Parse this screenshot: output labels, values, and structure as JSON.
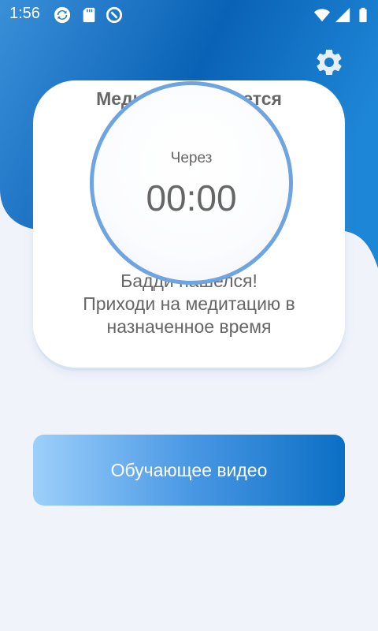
{
  "status_bar": {
    "time": "1:56",
    "left_icons": [
      "sync-icon",
      "sd-card-icon",
      "do-not-disturb-icon"
    ],
    "right_icons": [
      "wifi-icon",
      "cell-signal-icon",
      "battery-icon"
    ]
  },
  "header": {
    "settings_icon": "gear-icon"
  },
  "card": {
    "title": "Медитация начнется",
    "message_line1": "Бадди нашелся!",
    "message_line2": "Приходи на медитацию в",
    "message_line3": "назначенное время"
  },
  "timer": {
    "label": "Через",
    "value": "00:00"
  },
  "video_button": {
    "label": "Обучающее видео"
  },
  "colors": {
    "header_blue": "#0a6abf",
    "accent_light": "#9dd0fb",
    "accent_dark": "#0b6fc4",
    "ring": "#6ea4e0",
    "text_gray": "#666666",
    "background": "#f0f3fa"
  }
}
